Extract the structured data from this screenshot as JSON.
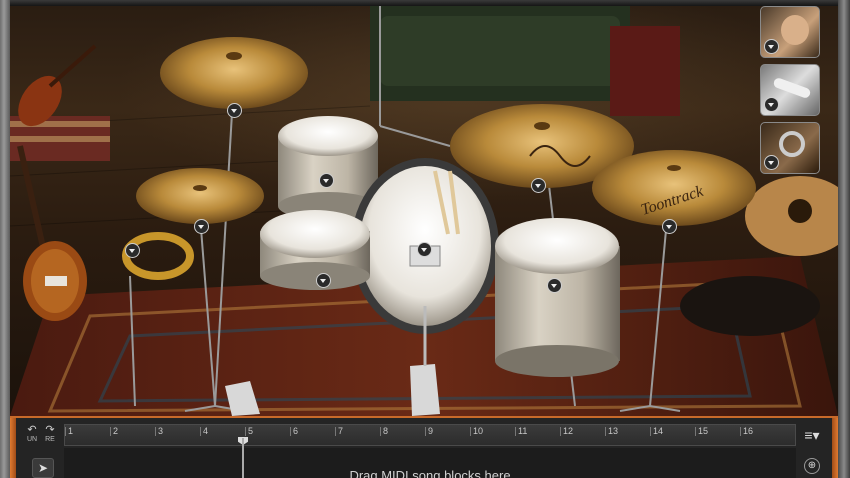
{
  "kit": {
    "cymbal_crash_left": "crash cymbal",
    "cymbal_ride": "ride cymbal",
    "cymbal_crash_right": "crash cymbal",
    "hihat": "hi-hat",
    "tom_rack": "rack tom",
    "snare": "snare drum",
    "kick": "kick drum",
    "tom_floor": "floor tom",
    "tambourine": "tambourine",
    "cymbal_brand": "Toontrack"
  },
  "percussion_panel": {
    "slots": [
      {
        "icon": "shaker-hand-icon"
      },
      {
        "icon": "shaker-tube-icon"
      },
      {
        "icon": "tambourine-hand-icon"
      }
    ]
  },
  "timeline": {
    "undo_label": "UN",
    "redo_label": "RE",
    "bars": [
      "1",
      "2",
      "3",
      "4",
      "5",
      "6",
      "7",
      "8",
      "9",
      "10",
      "11",
      "12",
      "13",
      "14",
      "15",
      "16"
    ],
    "drop_hint": "Drag MIDI song blocks here",
    "menu_glyph": "≡▾",
    "zoom_glyph": "⊕"
  },
  "colors": {
    "accent_orange": "#c86a2a",
    "cymbal_gold": "#b98a3a",
    "drum_pearl": "#cfc7b8"
  }
}
